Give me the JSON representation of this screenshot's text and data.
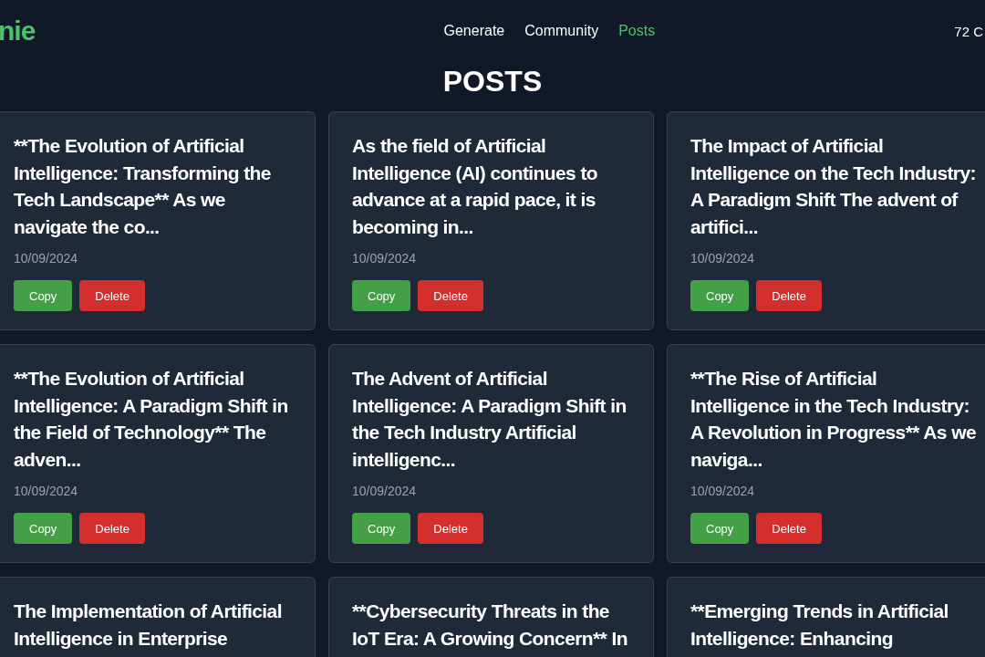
{
  "header": {
    "logo": "nie",
    "nav": [
      {
        "label": "Generate",
        "selected": false
      },
      {
        "label": "Community",
        "selected": false
      },
      {
        "label": "Posts",
        "selected": true
      }
    ],
    "credits": "72 C"
  },
  "page_title": "POSTS",
  "posts": [
    {
      "title": "**The Evolution of Artificial Intelligence: Transforming the Tech Landscape** As we navigate the co...",
      "date": "10/09/2024",
      "actions": [
        "Copy",
        "Delete"
      ]
    },
    {
      "title": "As the field of Artificial Intelligence (AI) continues to advance at a rapid pace, it is becoming in...",
      "date": "10/09/2024",
      "actions": [
        "Copy",
        "Delete"
      ]
    },
    {
      "title": "The Impact of Artificial Intelligence on the Tech Industry: A Paradigm Shift The advent of artifici...",
      "date": "10/09/2024",
      "actions": [
        "Copy",
        "Delete"
      ]
    },
    {
      "title": "**The Evolution of Artificial Intelligence: A Paradigm Shift in the Field of Technology** The adven...",
      "date": "10/09/2024",
      "actions": [
        "Copy",
        "Delete"
      ]
    },
    {
      "title": "The Advent of Artificial Intelligence: A Paradigm Shift in the Tech Industry Artificial intelligenc...",
      "date": "10/09/2024",
      "actions": [
        "Copy",
        "Delete"
      ]
    },
    {
      "title": "**The Rise of Artificial Intelligence in the Tech Industry: A Revolution in Progress** As we naviga...",
      "date": "10/09/2024",
      "actions": [
        "Copy",
        "Delete"
      ]
    },
    {
      "title": "The Implementation of Artificial Intelligence in Enterprise"
    },
    {
      "title": "**Cybersecurity Threats in the IoT Era: A Growing Concern** In"
    },
    {
      "title": "**Emerging Trends in Artificial Intelligence: Enhancing"
    }
  ]
}
